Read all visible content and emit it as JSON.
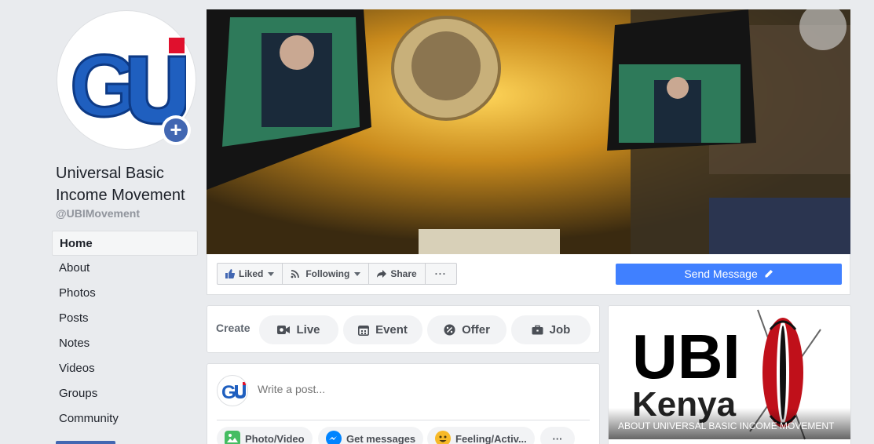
{
  "page": {
    "name": "Universal Basic Income Movement",
    "handle": "@UBIMovement",
    "avatar_text": "GU",
    "avatar_plus": "+"
  },
  "nav": {
    "items": [
      {
        "label": "Home",
        "active": true
      },
      {
        "label": "About"
      },
      {
        "label": "Photos"
      },
      {
        "label": "Posts"
      },
      {
        "label": "Notes"
      },
      {
        "label": "Videos"
      },
      {
        "label": "Groups"
      },
      {
        "label": "Community"
      }
    ]
  },
  "actions": {
    "liked": "Liked",
    "following": "Following",
    "share": "Share",
    "more": "···",
    "send_message": "Send Message"
  },
  "create": {
    "label": "Create",
    "live": "Live",
    "event": "Event",
    "offer": "Offer",
    "job": "Job"
  },
  "composer": {
    "placeholder": "Write a post...",
    "photo_video": "Photo/Video",
    "get_messages": "Get messages",
    "feeling": "Feeling/Activ...",
    "more": "···"
  },
  "about_card": {
    "logo_top": "UBI",
    "logo_bottom": "Kenya",
    "caption": "ABOUT UNIVERSAL BASIC INCOME MOVEMENT"
  },
  "colors": {
    "brand_blue": "#4267b2",
    "send_button": "#4080ff",
    "logo_blue": "#1f5fbf",
    "logo_red": "#e0102d"
  }
}
